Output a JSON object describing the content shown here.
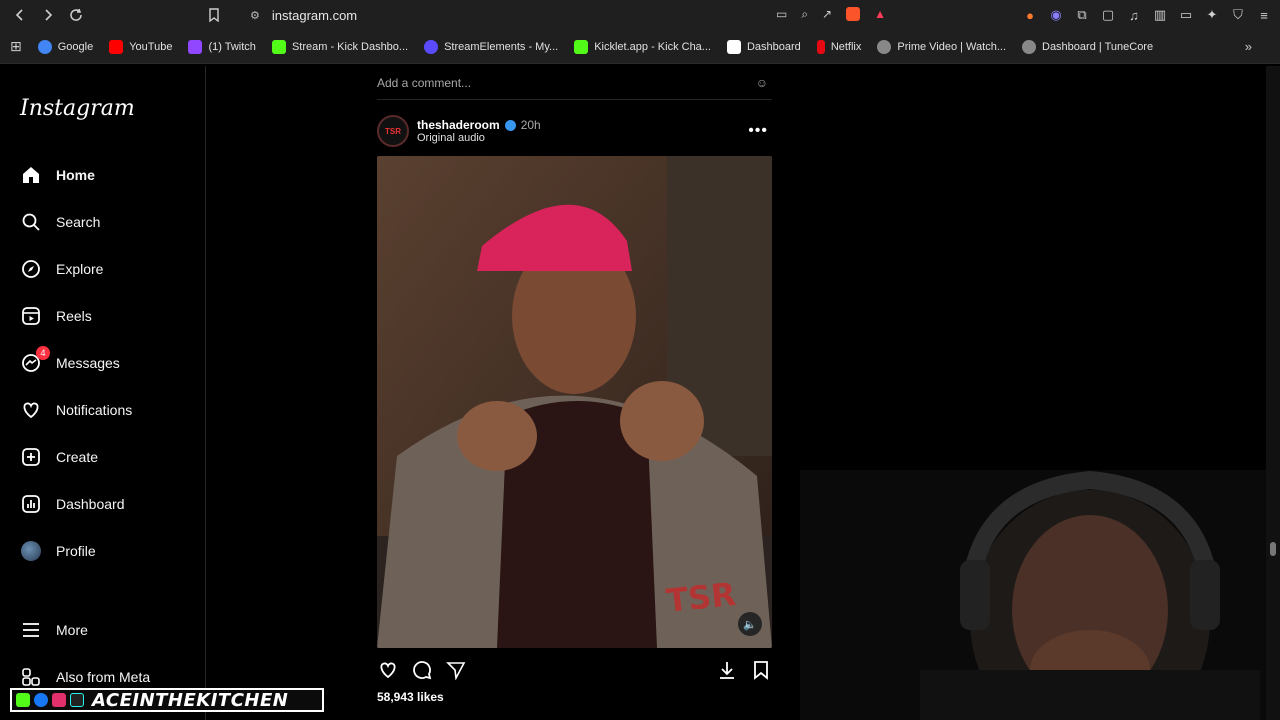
{
  "browser": {
    "url": "instagram.com",
    "bookmarks": [
      {
        "label": "Google",
        "color": "#4285f4"
      },
      {
        "label": "YouTube",
        "color": "#ff0000"
      },
      {
        "label": "(1) Twitch",
        "color": "#9146ff"
      },
      {
        "label": "Stream - Kick Dashbo...",
        "color": "#53fc18"
      },
      {
        "label": "StreamElements - My...",
        "color": "#5a4bff"
      },
      {
        "label": "Kicklet.app - Kick Cha...",
        "color": "#53fc18"
      },
      {
        "label": "Dashboard",
        "color": "#ffffff"
      },
      {
        "label": "Netflix",
        "color": "#e50914"
      },
      {
        "label": "Prime Video | Watch...",
        "color": "#aaaaaa"
      },
      {
        "label": "Dashboard | TuneCore",
        "color": "#aaaaaa"
      }
    ]
  },
  "sidebar": {
    "logo": "Instagram",
    "items": [
      {
        "label": "Home",
        "icon": "home-icon"
      },
      {
        "label": "Search",
        "icon": "search-icon"
      },
      {
        "label": "Explore",
        "icon": "explore-icon"
      },
      {
        "label": "Reels",
        "icon": "reels-icon"
      },
      {
        "label": "Messages",
        "icon": "messages-icon",
        "badge": "4"
      },
      {
        "label": "Notifications",
        "icon": "heart-icon"
      },
      {
        "label": "Create",
        "icon": "plus-icon"
      },
      {
        "label": "Dashboard",
        "icon": "dashboard-icon"
      },
      {
        "label": "Profile",
        "icon": "profile-avatar"
      }
    ],
    "more_label": "More",
    "also_from_meta": "Also from Meta"
  },
  "feed": {
    "add_comment_placeholder": "Add a comment...",
    "post": {
      "username": "theshaderoom",
      "time": "20h",
      "audio": "Original audio",
      "avatar_text": "TSR",
      "likes": "58,943 likes"
    }
  },
  "overlay": {
    "banner_text": "ACEINTHEKITCHEN"
  }
}
